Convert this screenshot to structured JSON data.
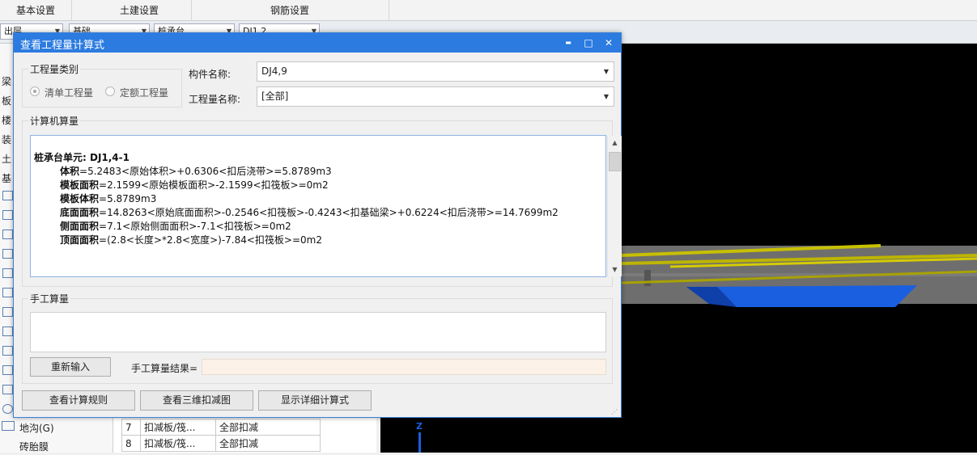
{
  "ribbon": {
    "tabs": [
      "基本设置",
      "土建设置",
      "钢筋设置"
    ]
  },
  "toolbar": {
    "combos": [
      "出层",
      "基础",
      "桩承台",
      "DJ1,2"
    ]
  },
  "left_panel": {
    "items": [
      "梁",
      "板",
      "楼",
      "装",
      "土",
      "基"
    ]
  },
  "tree": {
    "items": [
      "地沟(G)",
      "砖胎膜"
    ]
  },
  "grid": {
    "rows": [
      {
        "num": "7",
        "name": "扣减板/筏...",
        "value": "全部扣减"
      },
      {
        "num": "8",
        "name": "扣减板/筏...",
        "value": "全部扣减"
      }
    ]
  },
  "view3d": {
    "axis_label": "Z"
  },
  "dialog": {
    "title": "查看工程量计算式",
    "minimize": "▬",
    "maximize": "□",
    "close": "✕",
    "category_group": {
      "label": "工程量类别",
      "options": [
        "清单工程量",
        "定额工程量"
      ],
      "selected": "清单工程量"
    },
    "component_name": {
      "label": "构件名称:",
      "value": "DJ4,9"
    },
    "quantity_name": {
      "label": "工程量名称:",
      "value": "[全部]"
    },
    "computer_group": {
      "label": "计算机算量",
      "unit_title": "桩承台单元: DJ1,4-1",
      "lines": [
        {
          "name": "体积",
          "expr": "=5.2483<原始体积>+0.6306<扣后浇带>=5.8789m3"
        },
        {
          "name": "模板面积",
          "expr": "=2.1599<原始模板面积>-2.1599<扣筏板>=0m2"
        },
        {
          "name": "模板体积",
          "expr": "=5.8789m3"
        },
        {
          "name": "底面面积",
          "expr": "=14.8263<原始底面面积>-0.2546<扣筏板>-0.4243<扣基础梁>+0.6224<扣后浇带>=14.7699m2"
        },
        {
          "name": "侧面面积",
          "expr": "=7.1<原始侧面面积>-7.1<扣筏板>=0m2"
        },
        {
          "name": "顶面面积",
          "expr": "=(2.8<长度>*2.8<宽度>)-7.84<扣筏板>=0m2"
        }
      ]
    },
    "manual_group": {
      "label": "手工算量",
      "reinput_button": "重新输入",
      "result_label": "手工算量结果=",
      "result_value": ""
    },
    "buttons": {
      "view_rules": "查看计算规则",
      "view_3d_deduct": "查看三维扣减图",
      "show_detail": "显示详细计算式"
    }
  },
  "colors": {
    "titlebar": "#2b7be0",
    "view_bg": "#000000",
    "slab_blue": "#1a5fe0",
    "rebar_yellow": "#c8c000"
  }
}
